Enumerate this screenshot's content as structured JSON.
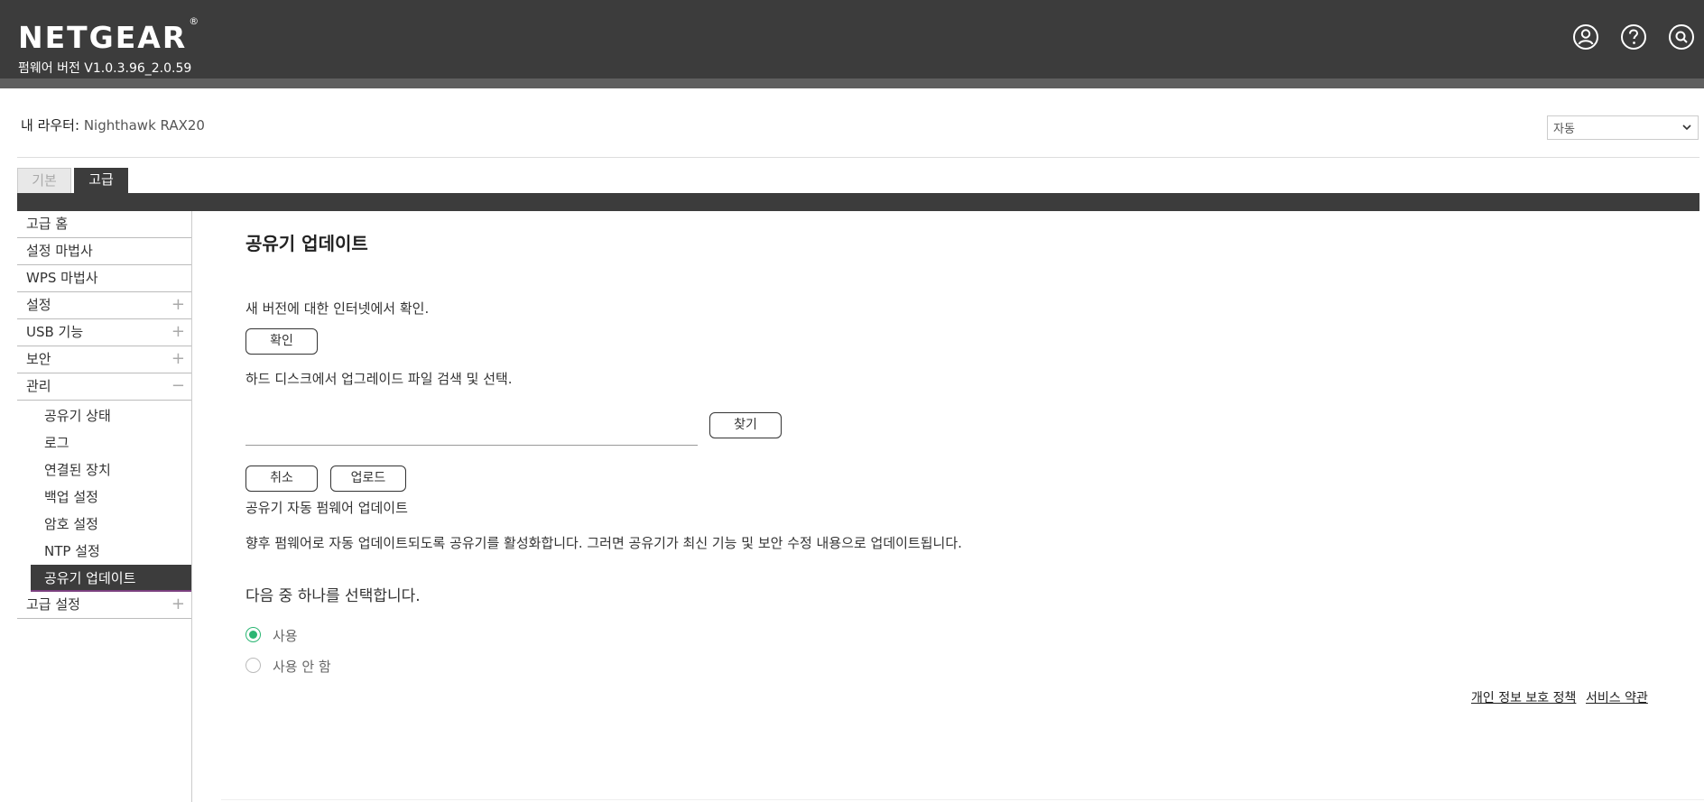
{
  "header": {
    "logo_text": "NETGEAR",
    "logo_reg": "®",
    "firmware": "펌웨어 버전 V1.0.3.96_2.0.59",
    "icons": [
      "user-icon",
      "help-icon",
      "search-icon"
    ]
  },
  "router": {
    "label": "내 라우터:",
    "value": "Nighthawk RAX20"
  },
  "language_select": {
    "value": "자동"
  },
  "tabs": [
    {
      "label": "기본",
      "active": false
    },
    {
      "label": "고급",
      "active": true
    }
  ],
  "sidebar": {
    "items": [
      {
        "label": "고급 홈"
      },
      {
        "label": "설정 마법사"
      },
      {
        "label": "WPS 마법사"
      },
      {
        "label": "설정",
        "toggle": "+"
      },
      {
        "label": "USB 기능",
        "toggle": "+"
      },
      {
        "label": "보안",
        "toggle": "+"
      },
      {
        "label": "관리",
        "toggle": "−"
      }
    ],
    "sub_items": [
      {
        "label": "공유기 상태"
      },
      {
        "label": "로그"
      },
      {
        "label": "연결된 장치"
      },
      {
        "label": "백업 설정"
      },
      {
        "label": "암호 설정"
      },
      {
        "label": "NTP 설정"
      },
      {
        "label": "공유기 업데이트",
        "active": true
      }
    ],
    "after_items": [
      {
        "label": "고급 설정",
        "toggle": "+"
      }
    ]
  },
  "main": {
    "title": "공유기 업데이트",
    "check_text": "새 버전에 대한 인터넷에서 확인.",
    "check_button": "확인",
    "select_text": "하드 디스크에서 업그레이드 파일 검색 및 선택.",
    "browse_button": "찾기",
    "cancel_button": "취소",
    "upload_button": "업로드",
    "auto_title": "공유기 자동 펌웨어 업데이트",
    "auto_desc": "향후 펌웨어로 자동 업데이트되도록 공유기를 활성화합니다. 그러면 공유기가 최신 기능 및 보안 수정 내용으로 업데이트됩니다.",
    "choose_text": "다음 중 하나를 선택합니다.",
    "options": [
      {
        "label": "사용",
        "selected": true
      },
      {
        "label": "사용 안 함",
        "selected": false
      }
    ]
  },
  "footer": {
    "privacy": "개인 정보 보호 정책",
    "terms": "서비스 약관"
  },
  "colors": {
    "header_bg": "#3c3c3c",
    "radio_accent": "#2bb673",
    "active_underline": "#7b3f7f"
  }
}
